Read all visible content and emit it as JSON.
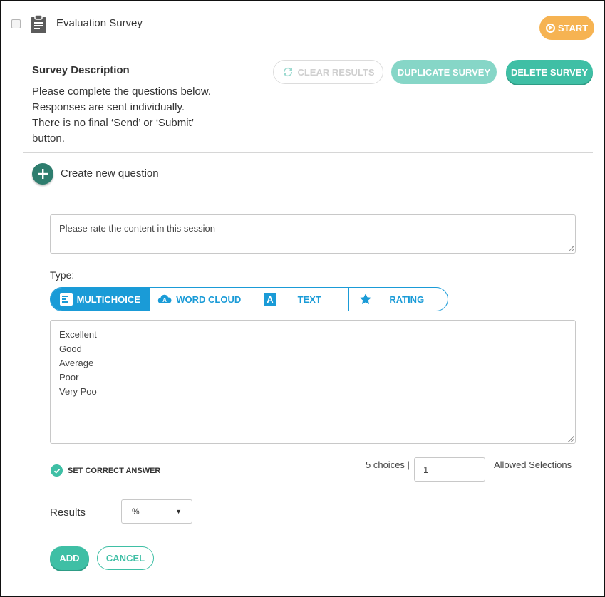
{
  "header": {
    "title": "Evaluation Survey",
    "start_label": "START"
  },
  "description": {
    "heading": "Survey Description",
    "lines": [
      "Please complete the questions below.",
      "Responses are sent individually.",
      "There is no final ‘Send’ or ‘Submit’",
      "button."
    ]
  },
  "actions": {
    "clear_results": "CLEAR RESULTS",
    "duplicate": "DUPLICATE SURVEY",
    "delete": "DELETE SURVEY"
  },
  "create": {
    "label": "Create new question"
  },
  "question": {
    "text": "Please rate the content in this session",
    "type_label": "Type:",
    "types": [
      {
        "label": "MULTICHOICE",
        "icon": "multichoice-icon",
        "active": true
      },
      {
        "label": "WORD CLOUD",
        "icon": "word-cloud-icon",
        "active": false
      },
      {
        "label": "TEXT",
        "icon": "text-icon",
        "active": false
      },
      {
        "label": "RATING",
        "icon": "star-icon",
        "active": false
      }
    ],
    "choices": [
      "Excellent",
      "Good",
      "Average",
      "Poor",
      "Very Poo"
    ],
    "set_correct_label": "SET CORRECT ANSWER",
    "choices_count": "5 choices |",
    "allowed_value": "1",
    "allowed_label": "Allowed Selections",
    "results_label": "Results",
    "results_value": "%",
    "add_label": "ADD",
    "cancel_label": "CANCEL"
  },
  "colors": {
    "accent_teal": "#3fbfa5",
    "accent_teal_light": "#86d6c7",
    "accent_blue": "#1a9bd7",
    "start_orange": "#f6b352",
    "plus_dark_teal": "#2e7d6e"
  }
}
